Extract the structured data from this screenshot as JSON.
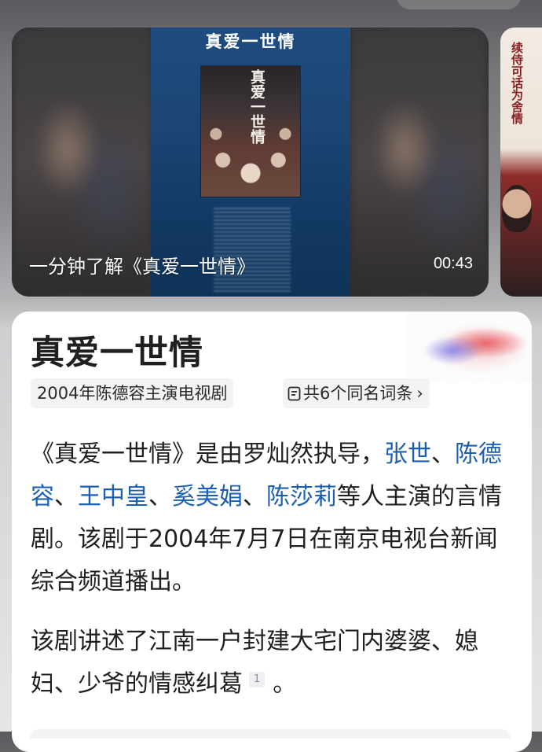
{
  "video": {
    "poster_title": "真爱一世情",
    "poster_image_title": "真爱一世情",
    "caption": "一分钟了解《真爱一世情》",
    "duration": "00:43"
  },
  "side_card": {
    "text": "续侍可话为舍情"
  },
  "entry": {
    "title": "真爱一世情",
    "subtitle_tag": "2004年陈德容主演电视剧",
    "homonym_tag": "共6个同名词条",
    "homonym_icon": "document-icon",
    "paragraph1": {
      "intro": "《真爱一世情》是由罗灿然执导，",
      "actors": [
        "张世",
        "陈德容",
        "王中皇",
        "奚美娟",
        "陈莎莉"
      ],
      "sep": "、",
      "outro": "等人主演的言情剧。该剧于2004年7月7日在南京电视台新闻综合频道播出。"
    },
    "paragraph2": {
      "text": "该剧讲述了江南一户封建大宅门内婆婆、媳妇、少爷的情感纠葛",
      "citation": "1",
      "end": "。"
    }
  },
  "colors": {
    "link": "#1a5fb4",
    "card_bg": "#ffffff",
    "tag_bg": "#f2f3f5"
  }
}
